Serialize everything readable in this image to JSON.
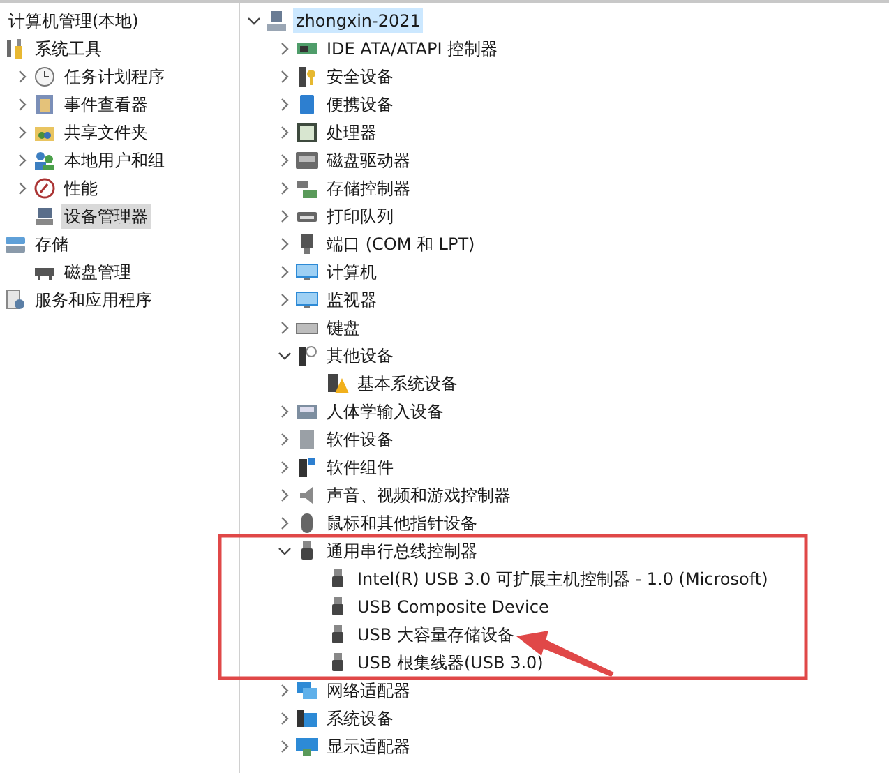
{
  "navigation_tree": [
    {
      "label": "计算机管理(本地)",
      "selected": false,
      "children": [
        {
          "label": "系统工具",
          "selected": false,
          "children": [
            {
              "label": "任务计划程序",
              "selected": false,
              "expanded": false
            },
            {
              "label": "事件查看器",
              "selected": false,
              "expanded": false
            },
            {
              "label": "共享文件夹",
              "selected": false,
              "expanded": false
            },
            {
              "label": "本地用户和组",
              "selected": false,
              "expanded": false
            },
            {
              "label": "性能",
              "selected": false,
              "expanded": false
            },
            {
              "label": "设备管理器",
              "selected": true
            }
          ]
        },
        {
          "label": "存储",
          "selected": false,
          "children": [
            {
              "label": "磁盘管理",
              "selected": false
            }
          ]
        },
        {
          "label": "服务和应用程序",
          "selected": false
        }
      ]
    }
  ],
  "device_tree": [
    {
      "label": "zhongxin-2021",
      "selected": true,
      "expanded": true,
      "children": [
        {
          "label": "IDE ATA/ATAPI 控制器",
          "selected": false,
          "expanded": false
        },
        {
          "label": "安全设备",
          "selected": false,
          "expanded": false
        },
        {
          "label": "便携设备",
          "selected": false,
          "expanded": false
        },
        {
          "label": "处理器",
          "selected": false,
          "expanded": false
        },
        {
          "label": "磁盘驱动器",
          "selected": false,
          "expanded": false
        },
        {
          "label": "存储控制器",
          "selected": false,
          "expanded": false
        },
        {
          "label": "打印队列",
          "selected": false,
          "expanded": false
        },
        {
          "label": "端口 (COM 和 LPT)",
          "selected": false,
          "expanded": false
        },
        {
          "label": "计算机",
          "selected": false,
          "expanded": false
        },
        {
          "label": "监视器",
          "selected": false,
          "expanded": false
        },
        {
          "label": "键盘",
          "selected": false,
          "expanded": false
        },
        {
          "label": "其他设备",
          "selected": false,
          "expanded": true,
          "children": [
            {
              "label": "基本系统设备",
              "selected": false
            }
          ]
        },
        {
          "label": "人体学输入设备",
          "selected": false,
          "expanded": false
        },
        {
          "label": "软件设备",
          "selected": false,
          "expanded": false
        },
        {
          "label": "软件组件",
          "selected": false,
          "expanded": false
        },
        {
          "label": "声音、视频和游戏控制器",
          "selected": false,
          "expanded": false
        },
        {
          "label": "鼠标和其他指针设备",
          "selected": false,
          "expanded": false
        },
        {
          "label": "通用串行总线控制器",
          "selected": false,
          "expanded": true,
          "children": [
            {
              "label": "Intel(R) USB 3.0 可扩展主机控制器 - 1.0 (Microsoft)",
              "selected": false
            },
            {
              "label": "USB Composite Device",
              "selected": false
            },
            {
              "label": "USB 大容量存储设备",
              "selected": false
            },
            {
              "label": "USB 根集线器(USB 3.0)",
              "selected": false
            }
          ]
        },
        {
          "label": "网络适配器",
          "selected": false,
          "expanded": false
        },
        {
          "label": "系统设备",
          "selected": false,
          "expanded": false
        },
        {
          "label": "显示适配器",
          "selected": false,
          "expanded": false
        }
      ]
    }
  ]
}
